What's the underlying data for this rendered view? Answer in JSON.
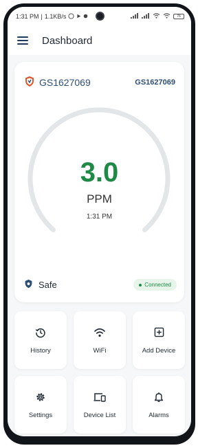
{
  "status_bar": {
    "time": "1:31 PM",
    "network_speed": "1.1KB/s",
    "battery": "76"
  },
  "app_bar": {
    "title": "Dashboard"
  },
  "device": {
    "id": "GS1627069",
    "id_right": "GS1627069",
    "reading_value": "3.0",
    "reading_unit": "PPM",
    "reading_time": "1:31 PM",
    "safety_status": "Safe",
    "connection_status": "Connected"
  },
  "tiles": [
    {
      "label": "History",
      "icon": "history-icon"
    },
    {
      "label": "WiFi",
      "icon": "wifi-icon"
    },
    {
      "label": "Add Device",
      "icon": "add-box-icon"
    },
    {
      "label": "Settings",
      "icon": "gear-icon"
    },
    {
      "label": "Device List",
      "icon": "devices-icon"
    },
    {
      "label": "Alarms",
      "icon": "bell-icon"
    }
  ],
  "colors": {
    "accent_green": "#1e8a46",
    "brand_navy": "#2d4d74",
    "shield_orange": "#e0552b",
    "gauge_track": "#e3e6e8"
  }
}
